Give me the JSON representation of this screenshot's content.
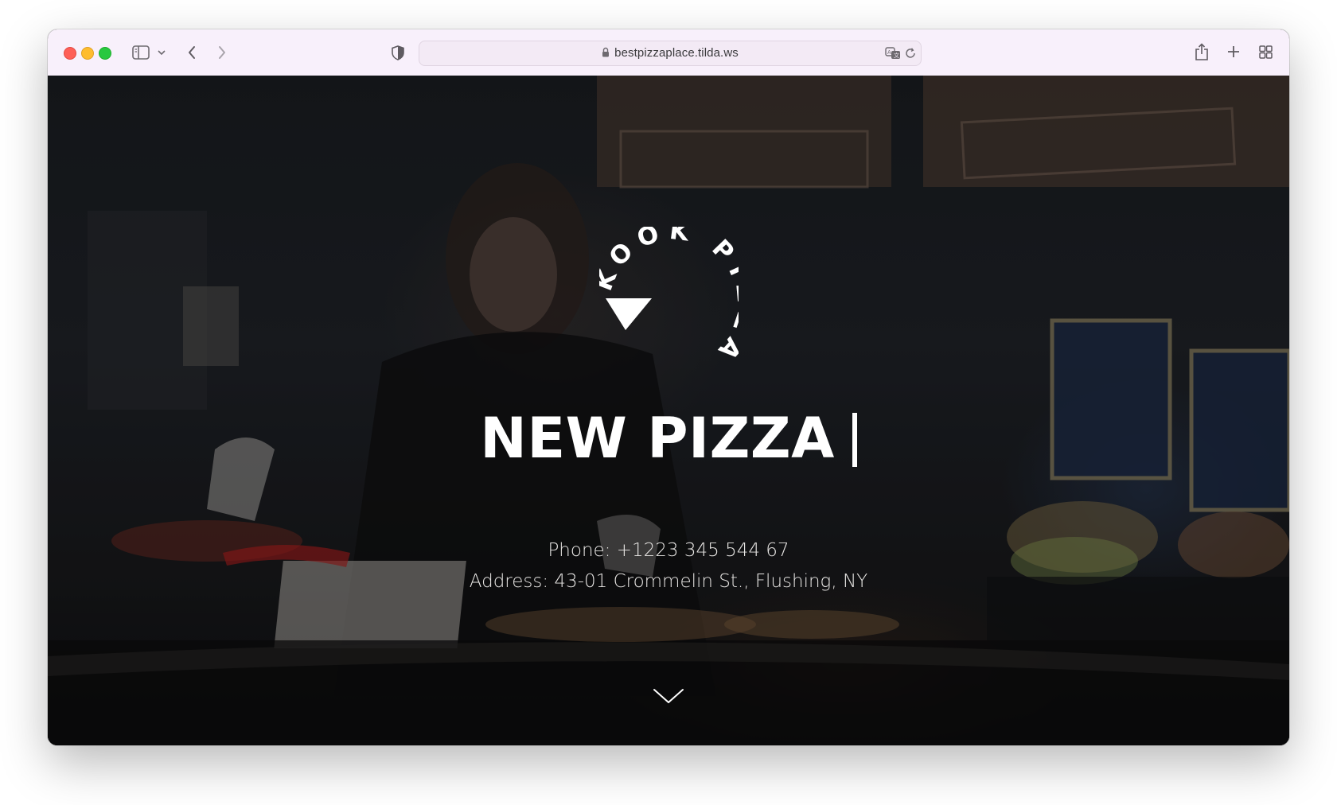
{
  "browser": {
    "url": "bestpizzaplace.tilda.ws",
    "icons": {
      "sidebar": "sidebar-icon",
      "sidebar_menu": "chevron-down-icon",
      "back": "chevron-left-icon",
      "forward": "chevron-right-icon",
      "privacy": "shield-icon",
      "lock": "lock-icon",
      "translate": "translate-icon",
      "reload": "reload-icon",
      "share": "share-icon",
      "new_tab": "plus-icon",
      "tab_overview": "tab-grid-icon"
    }
  },
  "hero": {
    "logo_text": "KOOK PIZZA",
    "headline": "NEW PIZZA",
    "phone": "Phone: +1223 345 544 67",
    "address": "Address: 43-01 Crommelin St., Flushing, NY",
    "scroll_icon": "chevron-down-icon"
  },
  "colors": {
    "toolbar_bg": "#f8f0fb",
    "hero_text": "#ffffff",
    "close": "#fe5f57",
    "minimize": "#febc2e",
    "zoom": "#28c840"
  }
}
